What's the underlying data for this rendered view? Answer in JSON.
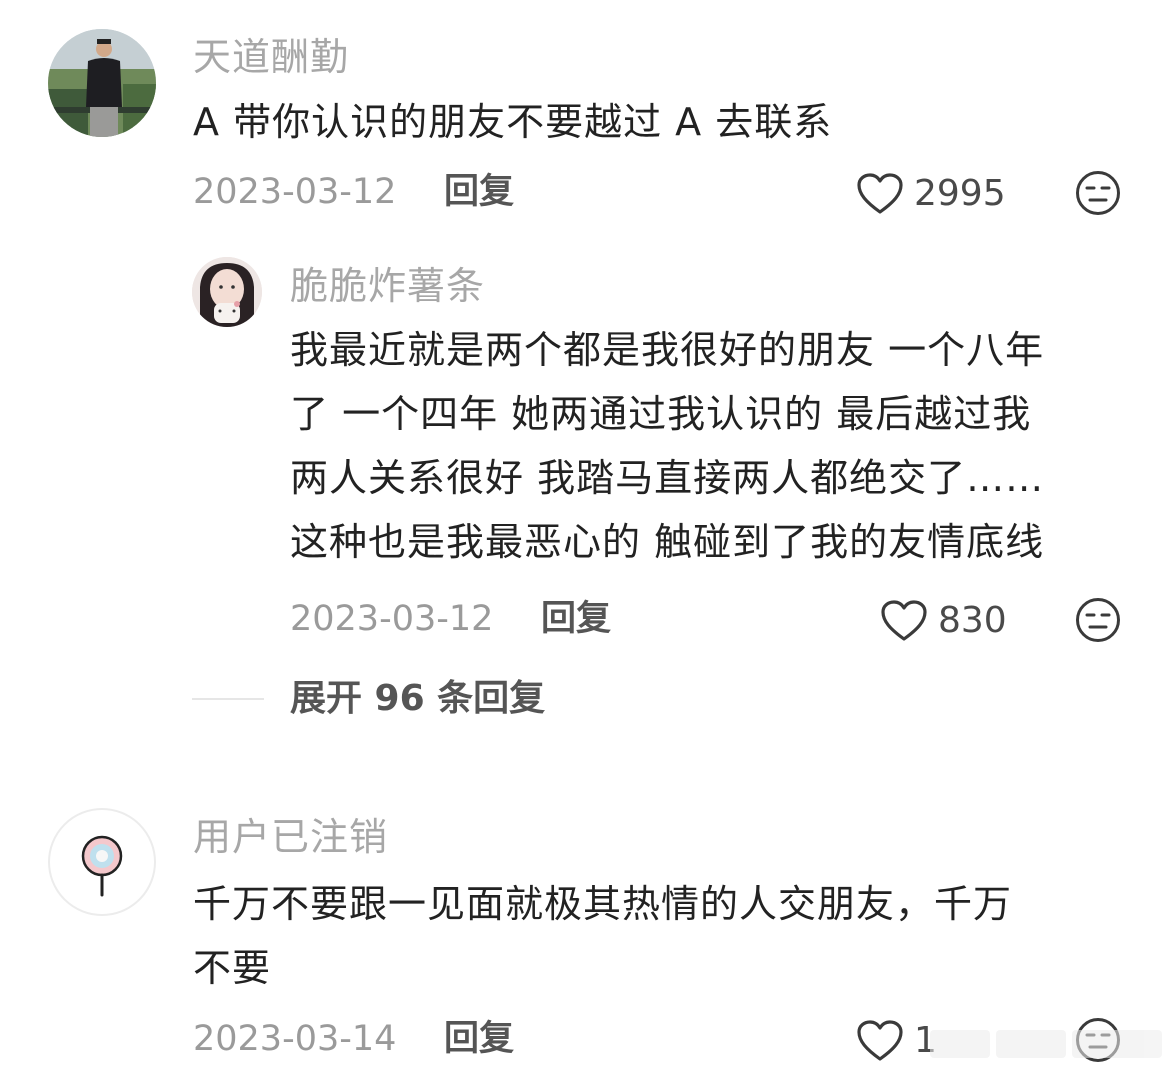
{
  "comments": [
    {
      "username": "天道酬勤",
      "text_lines": [
        "A 带你认识的朋友不要越过 A 去联系"
      ],
      "date": "2023-03-12",
      "reply_label": "回复",
      "likes": "2995"
    },
    {
      "username": "脆脆炸薯条",
      "text_lines": [
        "我最近就是两个都是我很好的朋友 一个八年",
        "了 一个四年 她两通过我认识的 最后越过我",
        "两人关系很好 我踏马直接两人都绝交了……",
        "这种也是我最恶心的 触碰到了我的友情底线"
      ],
      "date": "2023-03-12",
      "reply_label": "回复",
      "likes": "830"
    },
    {
      "username": "用户已注销",
      "text_lines": [
        "千万不要跟一见面就极其热情的人交朋友，千万",
        "不要"
      ],
      "date": "2023-03-14",
      "reply_label": "回复",
      "likes": "1"
    }
  ],
  "expand_replies": "展开 96 条回复",
  "icons": {
    "like": "heart-outline-icon",
    "dislike": "neutral-face-icon"
  },
  "colors": {
    "username": "#a7a7a7",
    "text": "#222222",
    "meta": "#9a9a9a"
  }
}
